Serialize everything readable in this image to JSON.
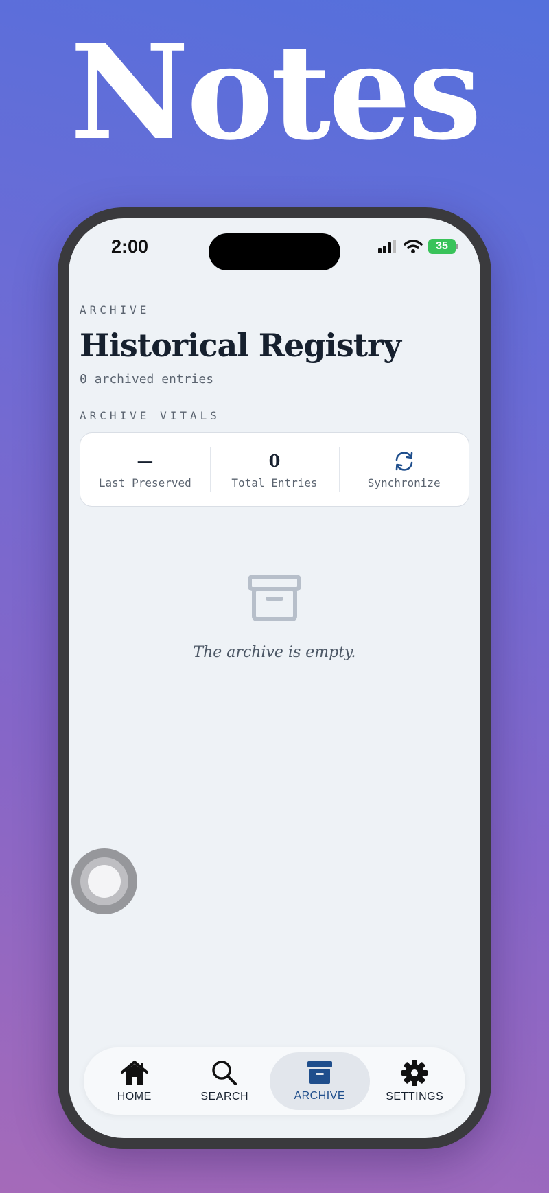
{
  "hero": {
    "title": "Notes"
  },
  "status_bar": {
    "time": "2:00",
    "battery": "35"
  },
  "header": {
    "eyebrow": "ARCHIVE",
    "title": "Historical Registry",
    "subtitle": "0 archived entries"
  },
  "vitals": {
    "section_label": "ARCHIVE VITALS",
    "items": [
      {
        "value": "—",
        "caption": "Last Preserved"
      },
      {
        "value": "0",
        "caption": "Total Entries"
      },
      {
        "caption": "Synchronize",
        "icon": "sync-icon"
      }
    ]
  },
  "empty_state": {
    "icon": "archive-box-icon",
    "message": "The archive is empty."
  },
  "tabbar": {
    "items": [
      {
        "label": "HOME",
        "icon": "home-icon"
      },
      {
        "label": "SEARCH",
        "icon": "search-icon"
      },
      {
        "label": "ARCHIVE",
        "icon": "archive-icon",
        "active": true
      },
      {
        "label": "SETTINGS",
        "icon": "gear-icon"
      }
    ]
  },
  "colors": {
    "accent": "#1f4e8c",
    "battery": "#39c35a",
    "screen_bg": "#eef2f6"
  }
}
